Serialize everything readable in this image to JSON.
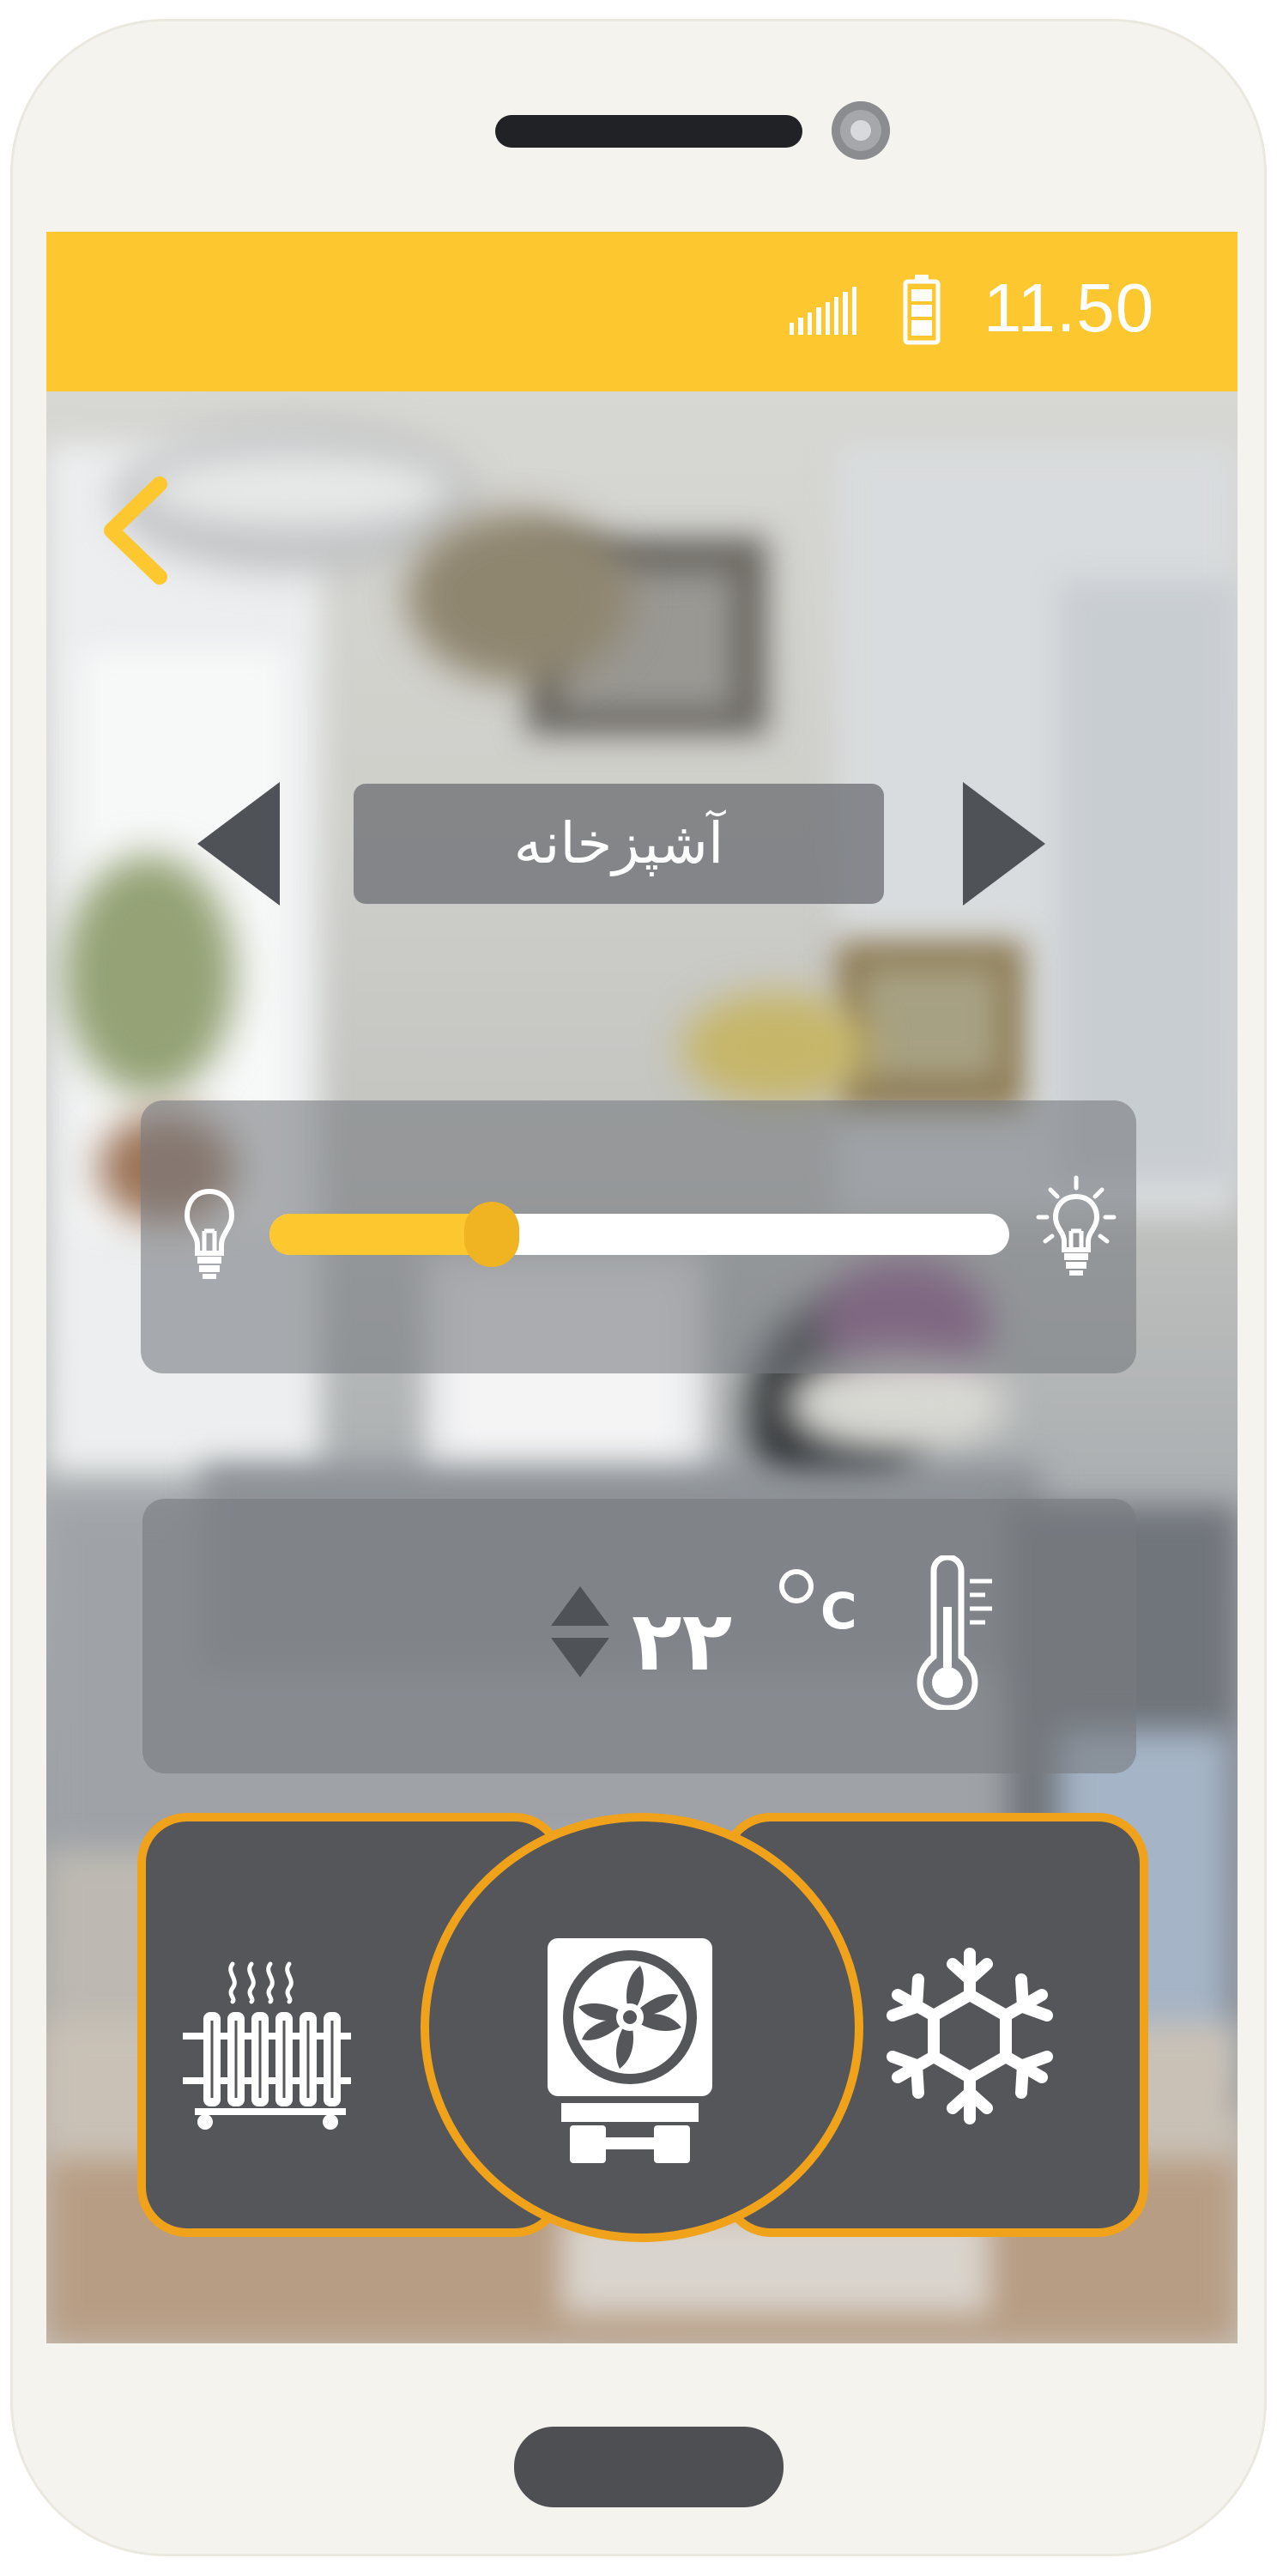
{
  "status_bar": {
    "time": "11.50",
    "signal_icon": "signal-bars-icon",
    "battery_icon": "battery-icon",
    "background": "#fcc72f"
  },
  "header": {
    "back_icon": "chevron-left-icon",
    "accent": "#fcc72f"
  },
  "room": {
    "name": "آشپزخانه",
    "prev_icon": "triangle-left-icon",
    "next_icon": "triangle-right-icon"
  },
  "light": {
    "level": 0.3,
    "min_icon": "lightbulb-off-icon",
    "max_icon": "lightbulb-on-icon",
    "track_color": "#ffffff",
    "fill_color": "#fcc72f"
  },
  "temperature": {
    "value": "۲۲",
    "unit": "C",
    "icon": "thermometer-icon"
  },
  "modes": {
    "items": [
      {
        "id": "heat",
        "icon": "radiator-icon"
      },
      {
        "id": "fan",
        "icon": "fan-icon",
        "selected": true
      },
      {
        "id": "cool",
        "icon": "snowflake-icon"
      }
    ],
    "border_color": "#f0a21b"
  }
}
